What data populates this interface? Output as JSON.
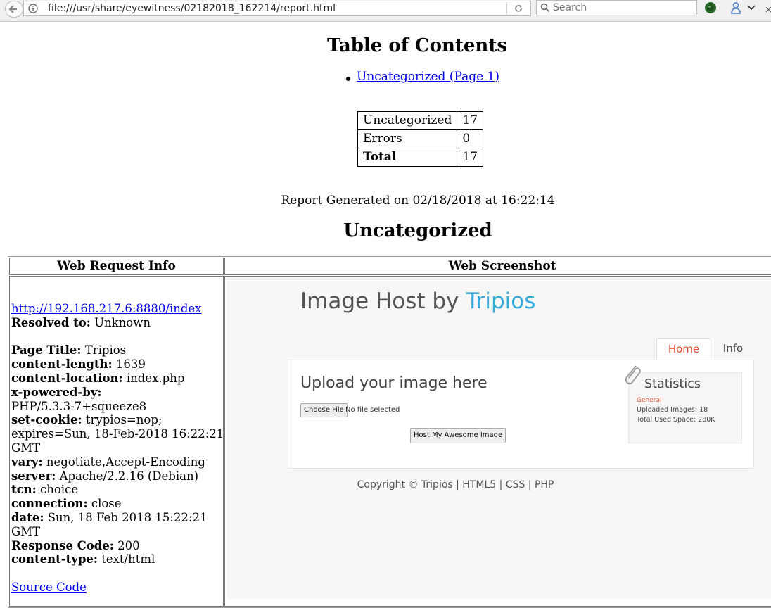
{
  "browser": {
    "url": "file:///usr/share/eyewitness/02182018_162214/report.html",
    "search_placeholder": "Search"
  },
  "toc": {
    "heading": "Table of Contents",
    "link": "Uncategorized (Page 1)"
  },
  "stats_table": [
    {
      "label": "Uncategorized",
      "value": "17",
      "bold": false
    },
    {
      "label": "Errors",
      "value": "0",
      "bold": false
    },
    {
      "label": "Total",
      "value": "17",
      "bold": true
    }
  ],
  "generated": "Report Generated on 02/18/2018 at 16:22:14",
  "section_heading": "Uncategorized",
  "columns": {
    "left": "Web Request Info",
    "right": "Web Screenshot"
  },
  "request_info": {
    "url": "http://192.168.217.6:8880/index",
    "lines": [
      {
        "k": "Resolved to:",
        "v": " Unknown"
      },
      {
        "k": "",
        "v": ""
      },
      {
        "k": "Page Title:",
        "v": " Tripios"
      },
      {
        "k": "content-length:",
        "v": " 1639"
      },
      {
        "k": "content-location:",
        "v": " index.php"
      },
      {
        "k": "x-powered-by:",
        "v": ""
      },
      {
        "k": "",
        "v": "PHP/5.3.3-7+squeeze8"
      },
      {
        "k": "set-cookie:",
        "v": " trypios=nop;"
      },
      {
        "k": "",
        "v": "expires=Sun, 18-Feb-2018 16:22:21"
      },
      {
        "k": "",
        "v": "GMT"
      },
      {
        "k": "vary:",
        "v": " negotiate,Accept-Encoding"
      },
      {
        "k": "server:",
        "v": " Apache/2.2.16 (Debian)"
      },
      {
        "k": "tcn:",
        "v": " choice"
      },
      {
        "k": "connection:",
        "v": " close"
      },
      {
        "k": "date:",
        "v": " Sun, 18 Feb 2018 15:22:21"
      },
      {
        "k": "",
        "v": "GMT"
      },
      {
        "k": "Response Code:",
        "v": " 200"
      },
      {
        "k": "content-type:",
        "v": " text/html"
      }
    ],
    "source_link": "Source Code"
  },
  "screenshot": {
    "title_plain": "Image Host by ",
    "title_brand": "Tripios",
    "tabs": [
      "Home",
      "Info"
    ],
    "upload_heading": "Upload your image here",
    "choose_file": "Choose File",
    "no_file": "No file selected",
    "host_button": "Host My Awesome Image",
    "stats_title": "Statistics",
    "stats_general": "General",
    "stats_uploaded": "Uploaded Images: 18",
    "stats_space": "Total Used Space: 280K",
    "copyright": "Copyright © Tripios | HTML5 | CSS | PHP"
  },
  "colors": {
    "link": "#0000ee",
    "brand": "#35aadc",
    "accent": "#e34a2b"
  }
}
